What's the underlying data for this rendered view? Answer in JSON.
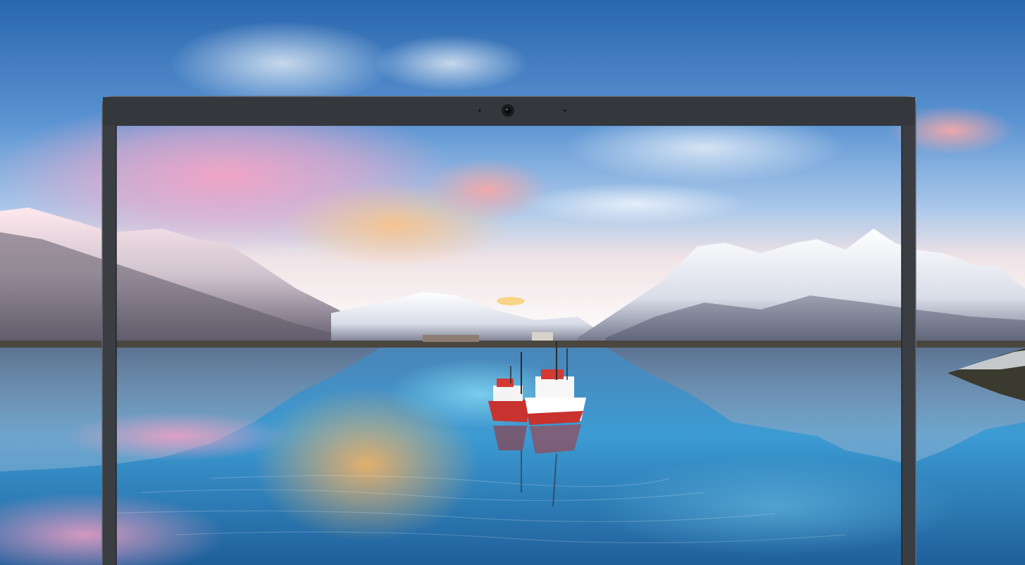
{
  "image": {
    "kind": "product-marketing-photo",
    "subject": "laptop-display-bezel",
    "bezel_color": "#3a3d42",
    "webcam_color": "#0d0e10",
    "sky_colors": [
      "#2f6fb5",
      "#6aa8e0",
      "#f2a7c6",
      "#f7c08a"
    ],
    "water_colors": [
      "#1c5a90",
      "#4aa6d8",
      "#f4b46a"
    ],
    "mountain_snow_color": "#f0f3f7",
    "boat_colors": [
      "#c8322f",
      "#ffffff",
      "#2c2c2c"
    ]
  }
}
